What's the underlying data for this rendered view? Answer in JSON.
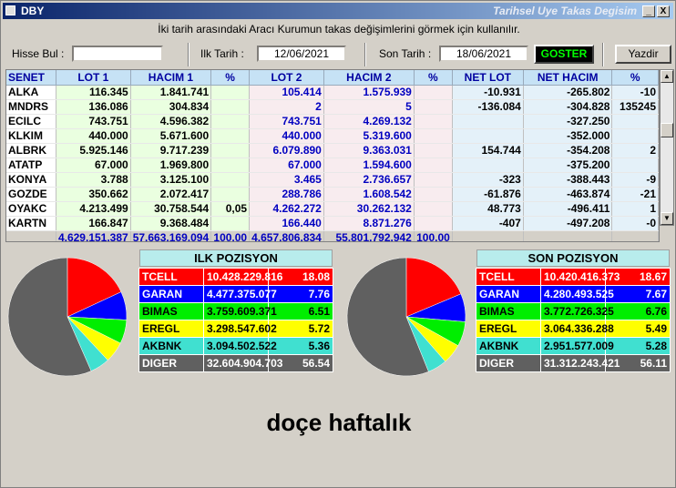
{
  "window": {
    "title": "DBY",
    "subtitle": "Tarihsel Uye Takas Degisim",
    "min_label": "_",
    "close_label": "X"
  },
  "info_text": "İki tarih arasındaki  Aracı Kurumun takas değişimlerini görmek için kullanılır.",
  "form": {
    "hisse_label": "Hisse Bul :",
    "hisse_value": "",
    "ilk_label": "Ilk Tarih :",
    "ilk_value": "12/06/2021",
    "son_label": "Son Tarih :",
    "son_value": "18/06/2021",
    "goster_label": "GOSTER",
    "yazdir_label": "Yazdir"
  },
  "grid": {
    "headers": [
      "SENET",
      "LOT 1",
      "HACIM 1",
      "%",
      "LOT 2",
      "HACIM 2",
      "%",
      "NET LOT",
      "NET HACIM",
      "%"
    ],
    "rows": [
      [
        "ALKA",
        "116.345",
        "1.841.741",
        "",
        "105.414",
        "1.575.939",
        "",
        "-10.931",
        "-265.802",
        "-10"
      ],
      [
        "MNDRS",
        "136.086",
        "304.834",
        "",
        "2",
        "5",
        "",
        "-136.084",
        "-304.828",
        "135245"
      ],
      [
        "ECILC",
        "743.751",
        "4.596.382",
        "",
        "743.751",
        "4.269.132",
        "",
        "",
        "-327.250",
        ""
      ],
      [
        "KLKIM",
        "440.000",
        "5.671.600",
        "",
        "440.000",
        "5.319.600",
        "",
        "",
        "-352.000",
        ""
      ],
      [
        "ALBRK",
        "5.925.146",
        "9.717.239",
        "",
        "6.079.890",
        "9.363.031",
        "",
        "154.744",
        "-354.208",
        "2"
      ],
      [
        "ATATP",
        "67.000",
        "1.969.800",
        "",
        "67.000",
        "1.594.600",
        "",
        "",
        "-375.200",
        ""
      ],
      [
        "KONYA",
        "3.788",
        "3.125.100",
        "",
        "3.465",
        "2.736.657",
        "",
        "-323",
        "-388.443",
        "-9"
      ],
      [
        "GOZDE",
        "350.662",
        "2.072.417",
        "",
        "288.786",
        "1.608.542",
        "",
        "-61.876",
        "-463.874",
        "-21"
      ],
      [
        "OYAKC",
        "4.213.499",
        "30.758.544",
        "0,05",
        "4.262.272",
        "30.262.132",
        "",
        "48.773",
        "-496.411",
        "1"
      ],
      [
        "KARTN",
        "166.847",
        "9.368.484",
        "",
        "166.440",
        "8.871.276",
        "",
        "-407",
        "-497.208",
        "-0"
      ]
    ],
    "totals": [
      "",
      "4.629.151.387",
      "57.663.169.094",
      "100,00",
      "4.657.806.834",
      "55.801.792.942",
      "100,00",
      "",
      "",
      ""
    ]
  },
  "ilk_pozisyon": {
    "title": "ILK POZISYON",
    "rows": [
      {
        "name": "TCELL",
        "value": "10.428.229.816",
        "pct": "18.08",
        "color": "#ff0000"
      },
      {
        "name": "GARAN",
        "value": "4.477.375.077",
        "pct": "7.76",
        "color": "#0000ff"
      },
      {
        "name": "BIMAS",
        "value": "3.759.609.371",
        "pct": "6.51",
        "color": "#00ee00"
      },
      {
        "name": "EREGL",
        "value": "3.298.547.602",
        "pct": "5.72",
        "color": "#ffff00"
      },
      {
        "name": "AKBNK",
        "value": "3.094.502.522",
        "pct": "5.36",
        "color": "#40e0d0"
      },
      {
        "name": "DIGER",
        "value": "32.604.904.703",
        "pct": "56.54",
        "color": "#606060"
      }
    ]
  },
  "son_pozisyon": {
    "title": "SON POZISYON",
    "rows": [
      {
        "name": "TCELL",
        "value": "10.420.416.373",
        "pct": "18.67",
        "color": "#ff0000"
      },
      {
        "name": "GARAN",
        "value": "4.280.493.525",
        "pct": "7.67",
        "color": "#0000ff"
      },
      {
        "name": "BIMAS",
        "value": "3.772.726.325",
        "pct": "6.76",
        "color": "#00ee00"
      },
      {
        "name": "EREGL",
        "value": "3.064.336.288",
        "pct": "5.49",
        "color": "#ffff00"
      },
      {
        "name": "AKBNK",
        "value": "2.951.577.009",
        "pct": "5.28",
        "color": "#40e0d0"
      },
      {
        "name": "DIGER",
        "value": "31.312.243.421",
        "pct": "56.11",
        "color": "#606060"
      }
    ]
  },
  "watermark": "doçe haftalık"
}
